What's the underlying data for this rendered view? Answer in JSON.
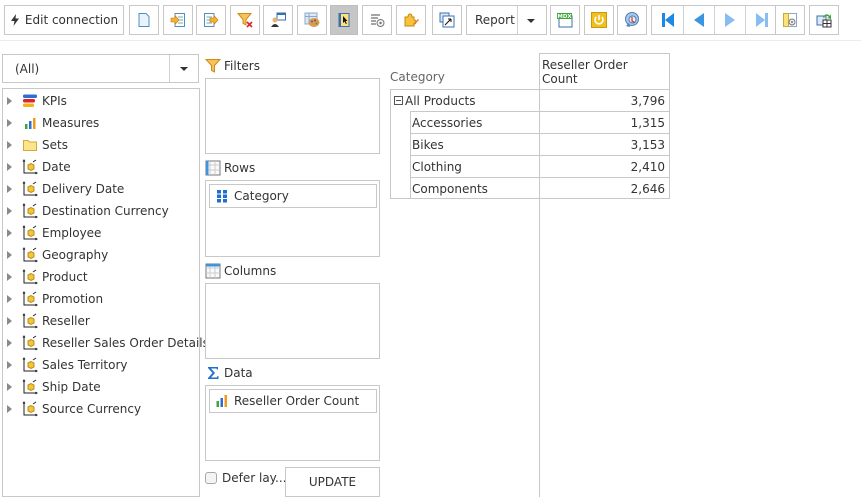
{
  "toolbar": {
    "edit_connection_label": "Edit connection",
    "report_label": "Report",
    "buttons": [
      {
        "name": "new-report",
        "icon": "blank-page-icon"
      },
      {
        "name": "import-report",
        "icon": "import-arrow-icon"
      },
      {
        "name": "export-report",
        "icon": "export-arrow-icon"
      },
      {
        "name": "clear-filters",
        "icon": "filter-clear-icon"
      },
      {
        "name": "user-settings",
        "icon": "user-grid-icon"
      },
      {
        "name": "layout-style",
        "icon": "palette-grid-icon"
      },
      {
        "name": "field-list-toggle",
        "icon": "pointer-panel-icon",
        "active": true
      },
      {
        "name": "options",
        "icon": "settings-list-icon"
      },
      {
        "name": "plugins",
        "icon": "puzzle-edit-icon"
      },
      {
        "name": "pivot-swap",
        "icon": "swap-axes-icon"
      },
      {
        "name": "mdx",
        "icon": "mdx-icon",
        "text": "MDX"
      },
      {
        "name": "power",
        "icon": "power-icon"
      },
      {
        "name": "drill-mode",
        "icon": "drill-globe-icon"
      },
      {
        "name": "first-page",
        "icon": "first-page-icon"
      },
      {
        "name": "prev-page",
        "icon": "prev-page-icon"
      },
      {
        "name": "next-page",
        "icon": "next-page-icon"
      },
      {
        "name": "last-page",
        "icon": "last-page-icon"
      },
      {
        "name": "panel-settings",
        "icon": "panel-gear-icon"
      },
      {
        "name": "refresh-data",
        "icon": "refresh-grid-icon"
      }
    ]
  },
  "field_list": {
    "filter_selected": "(All)",
    "items": [
      {
        "label": "KPIs",
        "icon": "kpi-icon"
      },
      {
        "label": "Measures",
        "icon": "measures-icon"
      },
      {
        "label": "Sets",
        "icon": "folder-icon"
      },
      {
        "label": "Date",
        "icon": "dimension-icon"
      },
      {
        "label": "Delivery Date",
        "icon": "dimension-icon"
      },
      {
        "label": "Destination Currency",
        "icon": "dimension-icon"
      },
      {
        "label": "Employee",
        "icon": "dimension-icon"
      },
      {
        "label": "Geography",
        "icon": "dimension-icon"
      },
      {
        "label": "Product",
        "icon": "dimension-icon"
      },
      {
        "label": "Promotion",
        "icon": "dimension-icon"
      },
      {
        "label": "Reseller",
        "icon": "dimension-icon"
      },
      {
        "label": "Reseller Sales Order Details",
        "icon": "dimension-icon"
      },
      {
        "label": "Sales Territory",
        "icon": "dimension-icon"
      },
      {
        "label": "Ship Date",
        "icon": "dimension-icon"
      },
      {
        "label": "Source Currency",
        "icon": "dimension-icon"
      }
    ]
  },
  "areas": {
    "filters": {
      "title": "Filters",
      "fields": []
    },
    "rows": {
      "title": "Rows",
      "fields": [
        "Category"
      ]
    },
    "columns": {
      "title": "Columns",
      "fields": []
    },
    "data": {
      "title": "Data",
      "fields": [
        "Reseller Order Count"
      ]
    }
  },
  "defer_layout": {
    "label": "Defer lay...",
    "checked": false
  },
  "update_label": "UPDATE",
  "pivot": {
    "row_header": "Category",
    "measure_header": "Reseller Order Count",
    "total": {
      "label": "All Products",
      "value": "3,796"
    },
    "rows": [
      {
        "label": "Accessories",
        "value": "1,315"
      },
      {
        "label": "Bikes",
        "value": "3,153"
      },
      {
        "label": "Clothing",
        "value": "2,410"
      },
      {
        "label": "Components",
        "value": "2,646"
      }
    ]
  }
}
